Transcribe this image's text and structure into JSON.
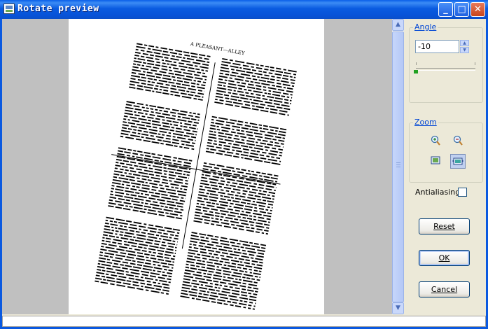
{
  "window": {
    "title": "Rotate preview",
    "minimize": "_",
    "maximize": "□",
    "close": "✕"
  },
  "preview": {
    "document_heading": "A PLEASANT—ALLEY"
  },
  "angle": {
    "group_label": "Angle",
    "value": "-10",
    "slider_value": -10
  },
  "zoom": {
    "group_label": "Zoom",
    "icons": [
      "zoom-in-icon",
      "zoom-out-icon",
      "fit-page-icon",
      "actual-size-icon"
    ]
  },
  "antialiasing": {
    "label": "Antialiasing",
    "checked": false
  },
  "buttons": {
    "reset": "Reset",
    "ok": "OK",
    "cancel": "Cancel"
  },
  "colors": {
    "title_bar": "#0a59e0",
    "accent": "#0046d5",
    "slider_knob": "#21a121"
  }
}
